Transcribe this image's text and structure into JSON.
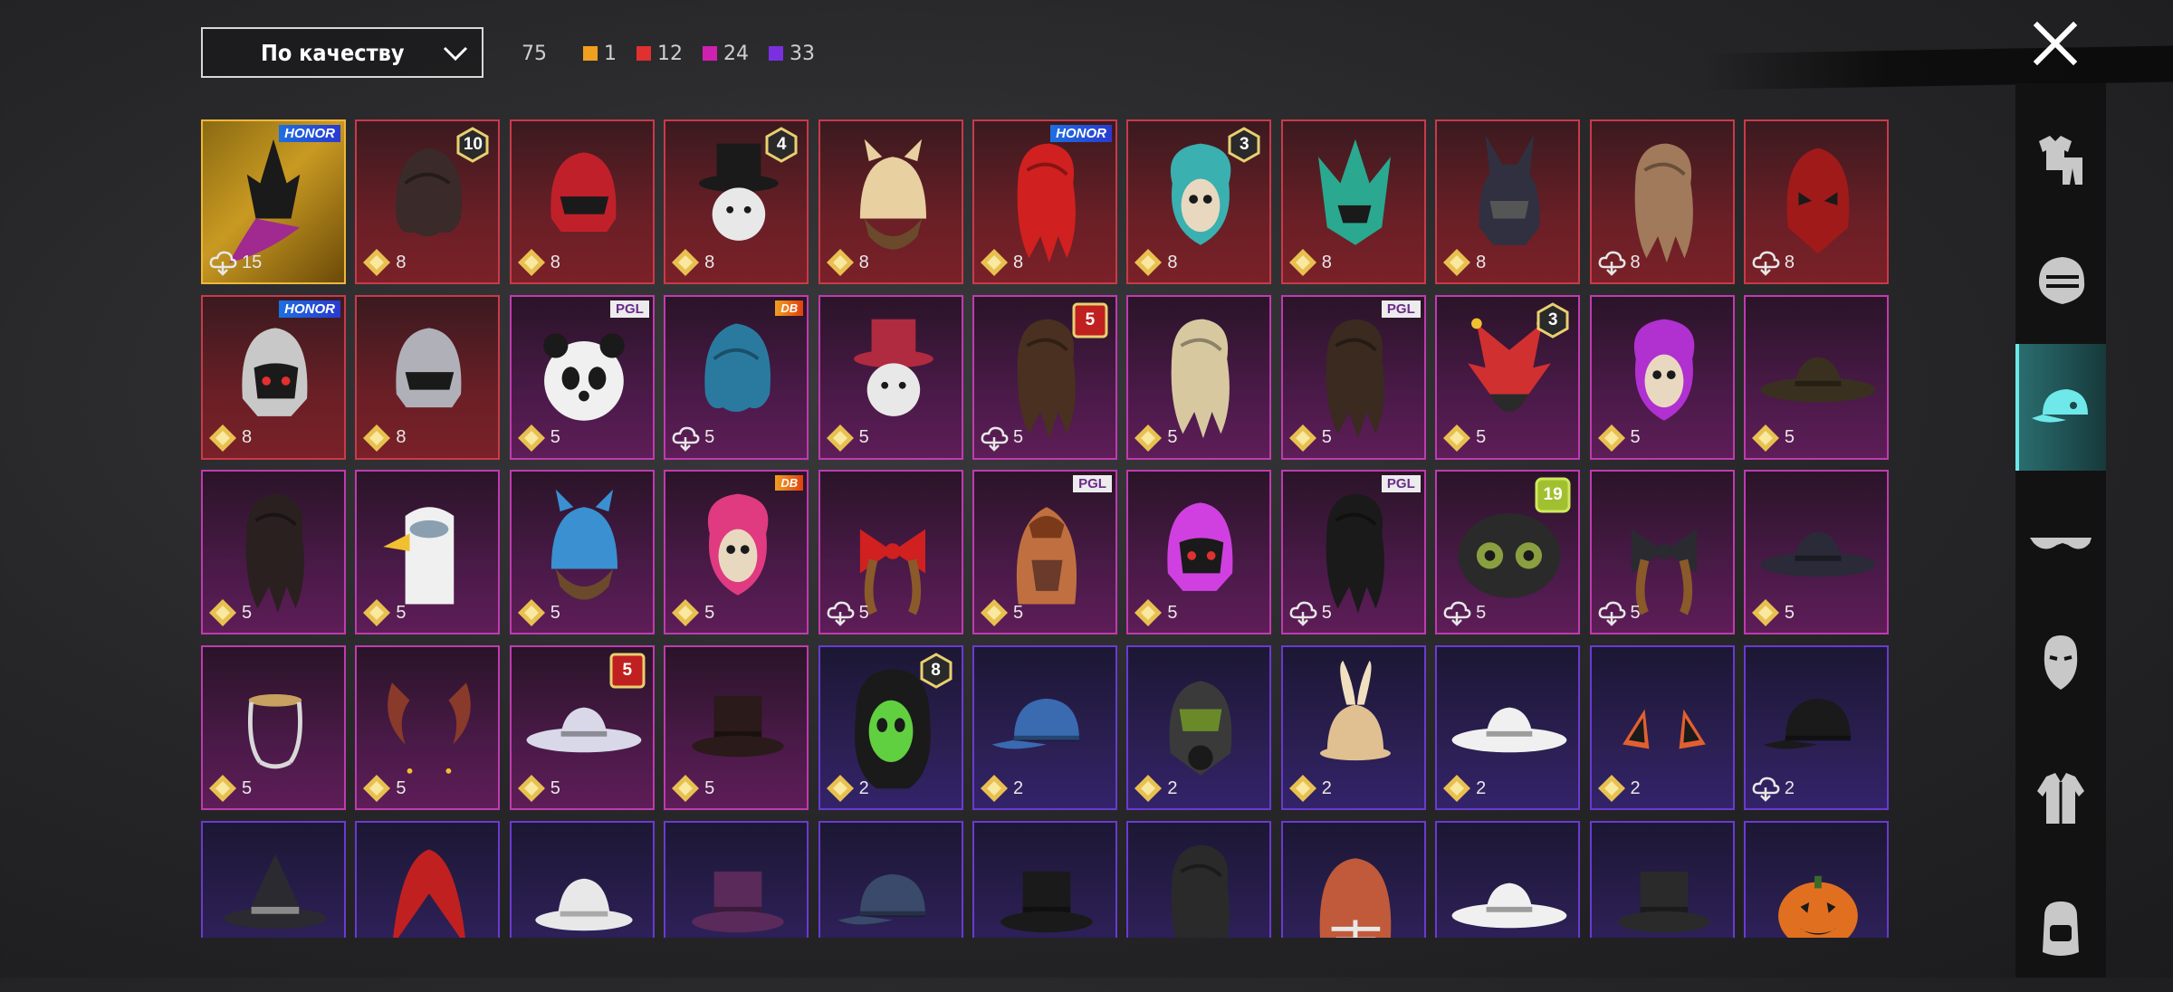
{
  "sort": {
    "label": "По качеству"
  },
  "counts": {
    "total": "75",
    "by_rarity": [
      {
        "color": "#f0a020",
        "value": "1"
      },
      {
        "color": "#e03030",
        "value": "12"
      },
      {
        "color": "#d020b0",
        "value": "24"
      },
      {
        "color": "#7a30e0",
        "value": "33"
      }
    ]
  },
  "sidebar": [
    {
      "name": "outfit",
      "icon": "outfit-icon",
      "active": false
    },
    {
      "name": "head",
      "icon": "mask-head-icon",
      "active": false
    },
    {
      "name": "hat",
      "icon": "cap-icon",
      "active": true
    },
    {
      "name": "glasses",
      "icon": "glasses-icon",
      "active": false
    },
    {
      "name": "face",
      "icon": "face-icon",
      "active": false
    },
    {
      "name": "top",
      "icon": "jacket-icon",
      "active": false
    },
    {
      "name": "backpack",
      "icon": "backpack-icon",
      "active": false
    }
  ],
  "items": [
    {
      "rarity": "gold",
      "art": "ornate-headdress",
      "color": "#a02a90",
      "logo": "HONOR",
      "source": "cloud",
      "count": "15"
    },
    {
      "rarity": "red",
      "art": "hair",
      "color": "#3a2a2a",
      "badge": "10",
      "source": "diamond",
      "count": "8"
    },
    {
      "rarity": "red",
      "art": "helmet",
      "color": "#c0202a",
      "source": "diamond",
      "count": "8"
    },
    {
      "rarity": "red",
      "art": "tophat-face",
      "color": "#1a1a1a",
      "badge": "4",
      "source": "diamond",
      "count": "8"
    },
    {
      "rarity": "red",
      "art": "creature-hat",
      "color": "#e8d0a0",
      "source": "diamond",
      "count": "8"
    },
    {
      "rarity": "red",
      "art": "hair-long",
      "color": "#d02020",
      "logo": "HONOR",
      "source": "diamond",
      "count": "8"
    },
    {
      "rarity": "red",
      "art": "mask-face",
      "color": "#3ab0b0",
      "badge": "3",
      "source": "diamond",
      "count": "8"
    },
    {
      "rarity": "red",
      "art": "helmet-spiky",
      "color": "#2aa890",
      "source": "diamond",
      "count": "8"
    },
    {
      "rarity": "red",
      "art": "helmet-ears",
      "color": "#303040",
      "source": "diamond",
      "count": "8"
    },
    {
      "rarity": "red",
      "art": "hair-long",
      "color": "#a07a5a",
      "source": "cloud",
      "count": "8"
    },
    {
      "rarity": "red",
      "art": "mask",
      "color": "#a01a1a",
      "source": "cloud",
      "count": "8"
    },
    {
      "rarity": "red",
      "art": "helmet-visor",
      "color": "#c8c8c8",
      "logo": "HONOR",
      "source": "diamond",
      "count": "8"
    },
    {
      "rarity": "red",
      "art": "helmet",
      "color": "#b0b0b8",
      "source": "diamond",
      "count": "8"
    },
    {
      "rarity": "magenta",
      "art": "panda",
      "color": "#f0f0f0",
      "logo": "PGL",
      "source": "diamond",
      "count": "5"
    },
    {
      "rarity": "magenta",
      "art": "hair",
      "color": "#2a7aa0",
      "logo": "DB",
      "source": "cloud",
      "count": "5"
    },
    {
      "rarity": "magenta",
      "art": "tophat-face",
      "color": "#b02a40",
      "source": "diamond",
      "count": "5"
    },
    {
      "rarity": "magenta",
      "art": "hair-long",
      "color": "#4a3020",
      "badge": "5",
      "source": "cloud",
      "count": "5"
    },
    {
      "rarity": "magenta",
      "art": "hair-long",
      "color": "#d8c8a0",
      "source": "diamond",
      "count": "5"
    },
    {
      "rarity": "magenta",
      "art": "hair-long",
      "color": "#3a2a20",
      "logo": "PGL",
      "source": "diamond",
      "count": "5"
    },
    {
      "rarity": "magenta",
      "art": "jester",
      "color": "#d03030",
      "badge": "3",
      "source": "diamond",
      "count": "5"
    },
    {
      "rarity": "magenta",
      "art": "mask-face",
      "color": "#b030d0",
      "source": "diamond",
      "count": "5"
    },
    {
      "rarity": "magenta",
      "art": "wide-hat",
      "color": "#3a3020",
      "source": "diamond",
      "count": "5"
    },
    {
      "rarity": "magenta",
      "art": "hair-long",
      "color": "#2a2020",
      "source": "diamond",
      "count": "5"
    },
    {
      "rarity": "magenta",
      "art": "bird-mask",
      "color": "#f0f0f0",
      "source": "diamond",
      "count": "5"
    },
    {
      "rarity": "magenta",
      "art": "creature-hat",
      "color": "#3a90d0",
      "source": "diamond",
      "count": "5"
    },
    {
      "rarity": "magenta",
      "art": "mask-face",
      "color": "#e03a80",
      "logo": "DB",
      "source": "diamond",
      "count": "5"
    },
    {
      "rarity": "magenta",
      "art": "bow",
      "color": "#d02020",
      "source": "cloud",
      "count": "5"
    },
    {
      "rarity": "magenta",
      "art": "snake-hood",
      "color": "#c07040",
      "logo": "PGL",
      "source": "diamond",
      "count": "5"
    },
    {
      "rarity": "magenta",
      "art": "helmet-visor",
      "color": "#d040e0",
      "source": "diamond",
      "count": "5"
    },
    {
      "rarity": "magenta",
      "art": "hair-long",
      "color": "#1a1a1a",
      "logo": "PGL",
      "source": "cloud",
      "count": "5"
    },
    {
      "rarity": "magenta",
      "art": "goggle-head",
      "color": "#2a2a2a",
      "badge": "19",
      "source": "cloud",
      "count": "5"
    },
    {
      "rarity": "magenta",
      "art": "bow",
      "color": "#2a2a30",
      "source": "cloud",
      "count": "5"
    },
    {
      "rarity": "magenta",
      "art": "wide-hat",
      "color": "#2a2a38",
      "source": "diamond",
      "count": "5"
    },
    {
      "rarity": "magenta",
      "art": "headband",
      "color": "#d8d8d8",
      "source": "diamond",
      "count": "5"
    },
    {
      "rarity": "magenta",
      "art": "horns",
      "color": "#8a3a2a",
      "source": "diamond",
      "count": "5"
    },
    {
      "rarity": "magenta",
      "art": "wide-hat",
      "color": "#d8d8e8",
      "badge": "5",
      "source": "diamond",
      "count": "5"
    },
    {
      "rarity": "magenta",
      "art": "tophat",
      "color": "#2a1a1a",
      "source": "diamond",
      "count": "5"
    },
    {
      "rarity": "purple",
      "art": "hair-skull",
      "color": "#60d040",
      "badge": "8",
      "source": "diamond",
      "count": "2"
    },
    {
      "rarity": "purple",
      "art": "cap",
      "color": "#3a6ab0",
      "source": "diamond",
      "count": "2"
    },
    {
      "rarity": "purple",
      "art": "gas-mask",
      "color": "#3a3a3a",
      "source": "diamond",
      "count": "2"
    },
    {
      "rarity": "purple",
      "art": "bunny-hat",
      "color": "#e0c090",
      "source": "diamond",
      "count": "2"
    },
    {
      "rarity": "purple",
      "art": "wide-hat",
      "color": "#f0f0f0",
      "source": "diamond",
      "count": "2"
    },
    {
      "rarity": "purple",
      "art": "ears",
      "color": "#e06030",
      "source": "diamond",
      "count": "2"
    },
    {
      "rarity": "purple",
      "art": "cap",
      "color": "#1a1a1a",
      "source": "cloud",
      "count": "2"
    },
    {
      "rarity": "purple",
      "art": "witch-hat",
      "color": "#2a2a30"
    },
    {
      "rarity": "purple",
      "art": "mohawk",
      "color": "#c02020"
    },
    {
      "rarity": "purple",
      "art": "bucket",
      "color": "#e8e8e8"
    },
    {
      "rarity": "purple",
      "art": "tophat",
      "color": "#5a2a5a"
    },
    {
      "rarity": "purple",
      "art": "cap",
      "color": "#3a4a6a"
    },
    {
      "rarity": "purple",
      "art": "tophat",
      "color": "#1a1a1a"
    },
    {
      "rarity": "purple",
      "art": "hair-long",
      "color": "#2a2a2a"
    },
    {
      "rarity": "purple",
      "art": "football-helmet",
      "color": "#c05a3a"
    },
    {
      "rarity": "purple",
      "art": "wide-hat",
      "color": "#f0f0f0"
    },
    {
      "rarity": "purple",
      "art": "tophat",
      "color": "#2a2a2a"
    },
    {
      "rarity": "purple",
      "art": "pumpkin",
      "color": "#e07020"
    }
  ]
}
